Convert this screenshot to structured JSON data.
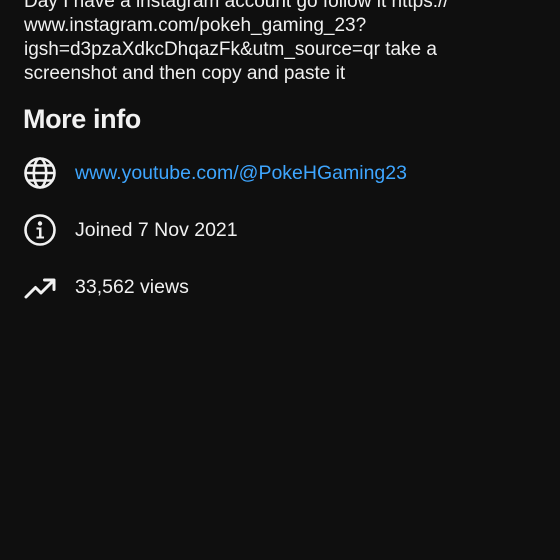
{
  "description": {
    "lines": [
      "Day I have a instagram account go follow it https://",
      "www.instagram.com/pokeh_gaming_23?",
      "igsh=d3pzaXdkcDhqazFk&utm_source=qr take a",
      "screenshot and then copy and paste it"
    ]
  },
  "more_info": {
    "heading": "More info",
    "link": {
      "icon": "globe-icon",
      "text": "www.youtube.com/@PokeHGaming23",
      "color": "#3ea6ff"
    },
    "joined": {
      "icon": "info-icon",
      "text": "Joined 7 Nov 2021"
    },
    "views": {
      "icon": "trending-up-icon",
      "text": "33,562 views"
    }
  },
  "theme": {
    "background": "#0f0f0f",
    "text": "#f1f1f1"
  }
}
